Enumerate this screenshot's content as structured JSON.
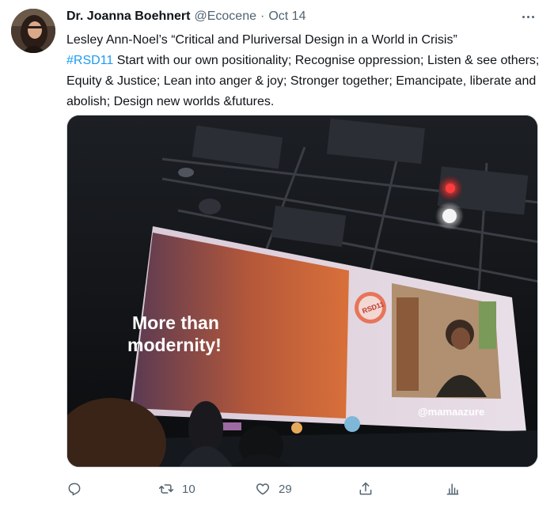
{
  "tweet": {
    "author_name": "Dr. Joanna Boehnert",
    "author_handle": "@Ecocene",
    "separator": "·",
    "date": "Oct 14",
    "text_before_hashtag": "Lesley Ann-Noel’s “Critical and Pluriversal Design in a World in Crisis”",
    "hashtag": "#RSD11",
    "text_after_hashtag": " Start with our own positionality; Recognise oppression; Listen & see others; Equity & Justice; Lean into anger & joy; Stronger together; Emancipate, liberate and abolish; Design new worlds &futures."
  },
  "media": {
    "slide_text_line1": "More than",
    "slide_text_line2": "modernity!",
    "logo_text": "RSD11",
    "video_caption": "@mamaazure"
  },
  "actions": {
    "reply_icon": "reply-icon",
    "retweet_icon": "retweet-icon",
    "retweet_count": "10",
    "like_icon": "heart-icon",
    "like_count": "29",
    "share_icon": "share-icon",
    "analytics_icon": "analytics-icon"
  },
  "colors": {
    "accent": "#1d9bf0",
    "muted": "#536471"
  }
}
